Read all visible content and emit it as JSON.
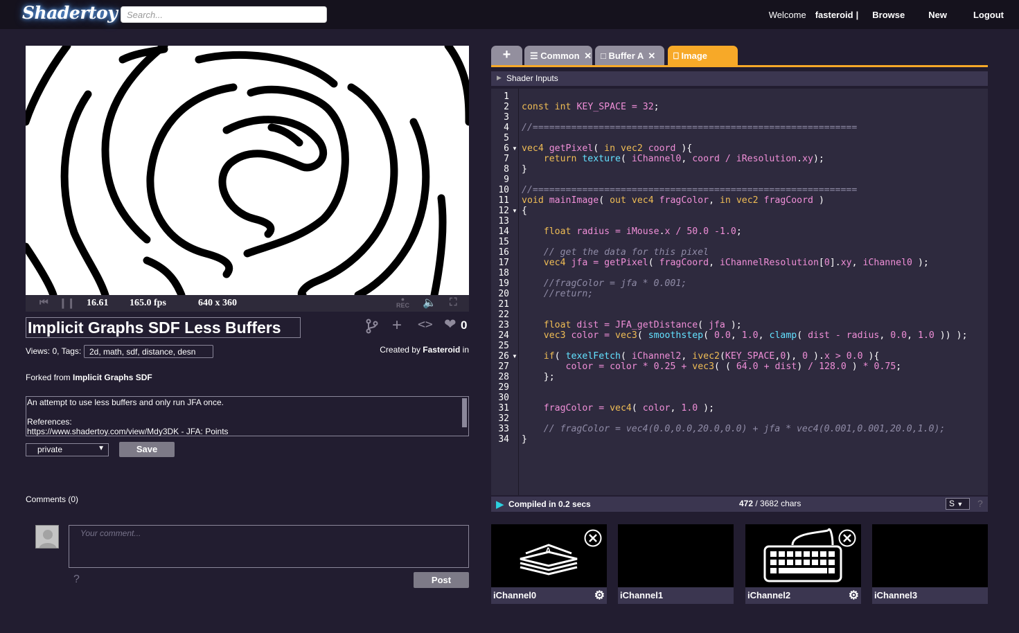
{
  "header": {
    "logo": "Shadertoy",
    "search_placeholder": "Search...",
    "welcome": "Welcome",
    "username": "fasteroid",
    "separator": "|",
    "browse": "Browse",
    "new": "New",
    "logout": "Logout"
  },
  "player": {
    "time": "16.61",
    "fps": "165.0 fps",
    "resolution": "640 x 360",
    "rec_label": "REC"
  },
  "shader": {
    "title": "Implicit Graphs SDF Less Buffers",
    "likes": "0",
    "views": "Views: 0, Tags:",
    "tags": "2d, math, sdf, distance, desn",
    "created_prefix": "Created by",
    "author": "Fasteroid",
    "created_suffix": "in",
    "forked_prefix": "Forked from",
    "forked_from": "Implicit Graphs SDF",
    "description_lines": [
      "An attempt to use less buffers and only run JFA once.",
      "",
      "References:",
      "https://www.shadertoy.com/view/Mdy3DK - JFA: Points"
    ],
    "visibility": "private",
    "save_label": "Save"
  },
  "comments": {
    "heading": "Comments (0)",
    "placeholder": "Your comment...",
    "help": "?",
    "post_label": "Post"
  },
  "editor": {
    "tabs": [
      {
        "label": "+"
      },
      {
        "label": "Common"
      },
      {
        "label": "Buffer A"
      },
      {
        "label": "Image"
      }
    ],
    "shader_inputs": "Shader Inputs",
    "status_compiled": "Compiled in 0.2 secs",
    "chars_used": "472",
    "chars_total": "/ 3682 chars",
    "font_select": "S",
    "help": "?",
    "line_count": 34,
    "code_lines": [
      "",
      "const int KEY_SPACE = 32;",
      "",
      "//===========================================================",
      "",
      "vec4 getPixel( in vec2 coord ){",
      "    return texture( iChannel0, coord / iResolution.xy);",
      "}",
      "",
      "//===========================================================",
      "void mainImage( out vec4 fragColor, in vec2 fragCoord )",
      "{",
      "",
      "    float radius = iMouse.x / 50.0 -1.0;",
      "",
      "    // get the data for this pixel",
      "    vec4 jfa = getPixel( fragCoord, iChannelResolution[0].xy, iChannel0 );",
      "",
      "    //fragColor = jfa * 0.001;",
      "    //return;",
      "",
      "",
      "    float dist = JFA_getDistance( jfa );",
      "    vec3 color = vec3( smoothstep( 0.0, 1.0, clamp( dist - radius, 0.0, 1.0 )) );",
      "",
      "    if( texelFetch( iChannel2, ivec2(KEY_SPACE,0), 0 ).x > 0.0 ){",
      "        color = color * 0.25 + vec3( ( 64.0 + dist) / 128.0 ) * 0.75;",
      "    };",
      "",
      "",
      "    fragColor = vec4( color, 1.0 );",
      "",
      "    // fragColor = vec4(0.0,0.0,20.0,0.0) + jfa * vec4(0.001,0.001,20.0,1.0);",
      "}"
    ]
  },
  "channels": [
    {
      "label": "iChannel0"
    },
    {
      "label": "iChannel1"
    },
    {
      "label": "iChannel2"
    },
    {
      "label": "iChannel3"
    }
  ],
  "colors": {
    "accent": "#f7a928",
    "background": "#221d30",
    "panel": "#3b3650"
  }
}
